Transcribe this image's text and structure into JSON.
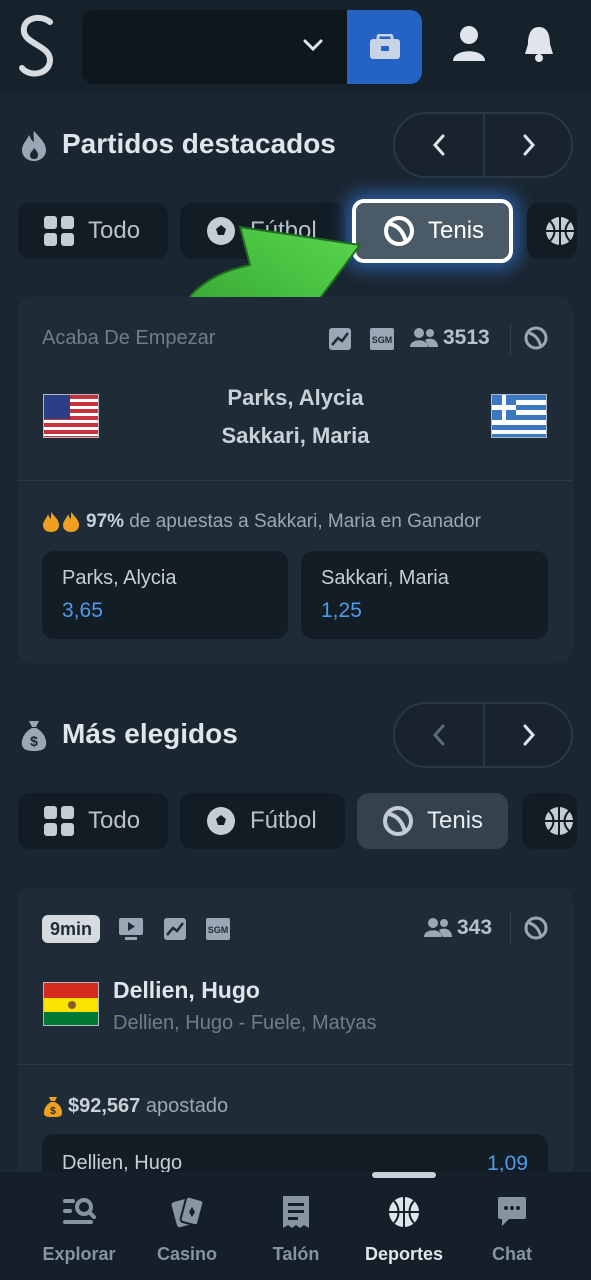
{
  "header": {
    "logo_letter": "S",
    "account_value": ""
  },
  "section1": {
    "title": "Partidos destacados",
    "chips": [
      "Todo",
      "Fútbol",
      "Tenis"
    ]
  },
  "match1": {
    "status": "Acaba De Empezar",
    "viewers": "3513",
    "team1": "Parks, Alycia",
    "team2": "Sakkari, Maria",
    "bet_pct": "97%",
    "bet_text": " de apuestas a Sakkari, Maria en Ganador",
    "odds": [
      {
        "name": "Parks, Alycia",
        "value": "3,65"
      },
      {
        "name": "Sakkari, Maria",
        "value": "1,25"
      }
    ]
  },
  "section2": {
    "title": "Más elegidos",
    "chips": [
      "Todo",
      "Fútbol",
      "Tenis"
    ]
  },
  "match2": {
    "time_badge": "9min",
    "viewers": "343",
    "player": "Dellien, Hugo",
    "event": "Dellien, Hugo - Fuele, Matyas",
    "amount": "$92,567",
    "amount_suffix": " apostado",
    "odds": [
      {
        "name": "Dellien, Hugo",
        "value": "1,09"
      }
    ]
  },
  "bottom_nav": [
    {
      "label": "Explorar",
      "icon": "explore-icon"
    },
    {
      "label": "Casino",
      "icon": "cards-icon"
    },
    {
      "label": "Talón",
      "icon": "ticket-icon"
    },
    {
      "label": "Deportes",
      "icon": "basketball-icon"
    },
    {
      "label": "Chat",
      "icon": "chat-icon"
    }
  ],
  "colors": {
    "accent_blue": "#2463c4",
    "odds_blue": "#4f9be8",
    "background": "#1a2631",
    "fire_orange": "#f0a020"
  }
}
